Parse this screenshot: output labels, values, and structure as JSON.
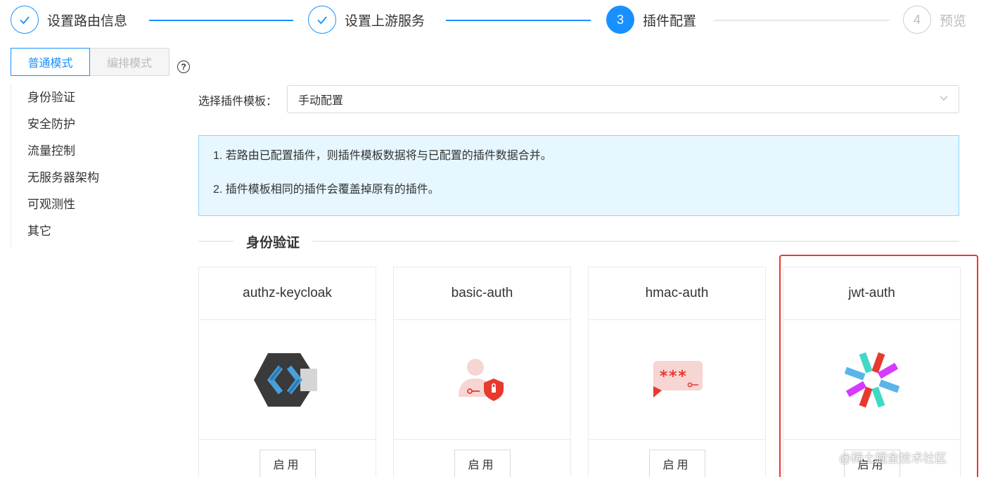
{
  "steps": [
    {
      "number": "",
      "label": "设置路由信息",
      "state": "done"
    },
    {
      "number": "",
      "label": "设置上游服务",
      "state": "done"
    },
    {
      "number": "3",
      "label": "插件配置",
      "state": "active"
    },
    {
      "number": "4",
      "label": "预览",
      "state": "wait"
    }
  ],
  "mode": {
    "normal": "普通模式",
    "orchestration": "编排模式",
    "help_icon": "question-circle-icon"
  },
  "sidebar": {
    "items": [
      "身份验证",
      "安全防护",
      "流量控制",
      "无服务器架构",
      "可观测性",
      "其它"
    ]
  },
  "template": {
    "label": "选择插件模板：",
    "value": "手动配置"
  },
  "info": {
    "line1": "1. 若路由已配置插件，则插件模板数据将与已配置的插件数据合并。",
    "line2": "2. 插件模板相同的插件会覆盖掉原有的插件。"
  },
  "category": {
    "title": "身份验证"
  },
  "plugins": [
    {
      "name": "authz-keycloak",
      "button": "启用",
      "icon": "keycloak-icon"
    },
    {
      "name": "basic-auth",
      "button": "启用",
      "icon": "user-lock-icon"
    },
    {
      "name": "hmac-auth",
      "button": "启用",
      "icon": "password-chat-icon"
    },
    {
      "name": "jwt-auth",
      "button": "启用",
      "icon": "jwt-icon"
    }
  ],
  "colors": {
    "accent": "#1890ff",
    "highlight": "#e8392f",
    "info_bg": "#e6f7ff"
  },
  "watermark": "@稀土掘金技术社区"
}
